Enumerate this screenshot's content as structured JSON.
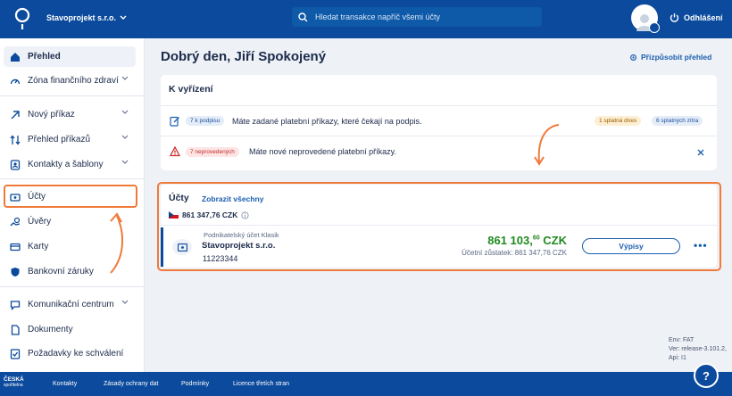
{
  "header": {
    "company": "Stavoprojekt s.r.o.",
    "search_placeholder": "Hledat transakce napříč všemi účty",
    "logout": "Odhlášení"
  },
  "sidebar": {
    "items": [
      {
        "label": "Přehled",
        "icon": "home-icon",
        "active": true
      },
      {
        "label": "Zóna finančního zdraví",
        "icon": "gauge-icon",
        "chevron": true
      },
      {
        "label": "Nový příkaz",
        "icon": "arrow-up-right-icon",
        "chevron": true
      },
      {
        "label": "Přehled příkazů",
        "icon": "swap-arrows-icon",
        "chevron": true
      },
      {
        "label": "Kontakty a šablony",
        "icon": "contacts-icon",
        "chevron": true
      },
      {
        "label": "Účty",
        "icon": "wallet-icon"
      },
      {
        "label": "Úvěry",
        "icon": "coins-icon"
      },
      {
        "label": "Karty",
        "icon": "card-icon"
      },
      {
        "label": "Bankovní záruky",
        "icon": "shield-icon"
      },
      {
        "label": "Komunikační centrum",
        "icon": "chat-icon",
        "chevron": true
      },
      {
        "label": "Dokumenty",
        "icon": "document-icon"
      },
      {
        "label": "Požadavky ke schválení",
        "icon": "approval-icon"
      }
    ]
  },
  "main": {
    "greeting": "Dobrý den, Jiří Spokojený",
    "customize": "Přizpůsobit přehled",
    "todo": {
      "title": "K vyřízení",
      "rows": [
        {
          "badge": "7 k podpisu",
          "text": "Máte zadané platební příkazy, které čekají na podpis.",
          "tags": [
            "1 splatná dnes",
            "6 splatných zítra"
          ]
        },
        {
          "badge": "7 neprovedených",
          "text": "Máte nové neprovedené platební příkazy."
        }
      ]
    },
    "accounts": {
      "title": "Účty",
      "show_all": "Zobrazit všechny",
      "total": "861 347,76 CZK",
      "account": {
        "type": "Podnikatelský účet Klasik",
        "name": "Stavoprojekt s.r.o.",
        "number": "11223344",
        "balance_main": "861 103,",
        "balance_cents": "60",
        "balance_currency": " CZK",
        "accounting_balance": "Účetní zůstatek: 861 347,76 CZK",
        "statements_button": "Výpisy"
      }
    }
  },
  "env": {
    "line1": "Env: FAT",
    "line2": "Ver: release-3.101.2,",
    "line3": "Api: I1"
  },
  "footer": {
    "logo_line1": "ČESKÁ",
    "logo_line2": "spořitelna",
    "links": [
      "Kontakty",
      "Zásady ochrany dat",
      "Podmínky",
      "Licence třetích stran"
    ]
  },
  "colors": {
    "brand": "#0b4a9c",
    "highlight": "#f07a3a",
    "balance": "#1f8a1f"
  }
}
